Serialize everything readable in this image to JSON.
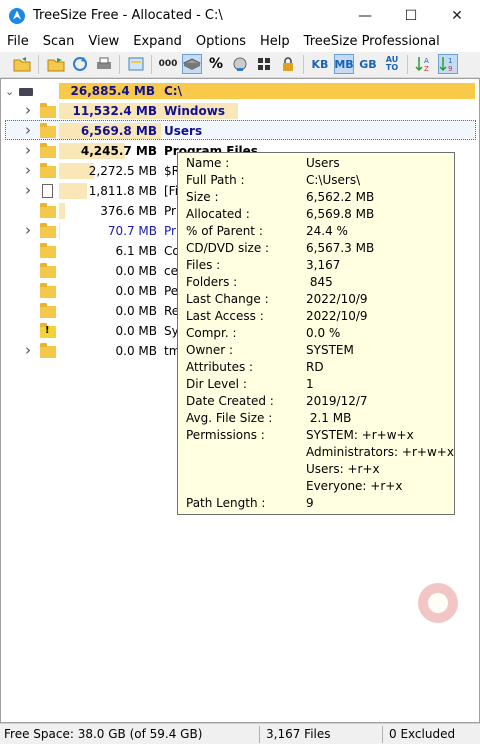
{
  "window": {
    "title": "TreeSize Free - Allocated - C:\\",
    "minimize_icon": "minimize-icon",
    "maximize_icon": "maximize-icon",
    "close_icon": "close-icon",
    "minimize_glyph": "—",
    "maximize_glyph": "☐",
    "close_glyph": "✕"
  },
  "menu": [
    "File",
    "Scan",
    "View",
    "Expand",
    "Options",
    "Help",
    "TreeSize Professional"
  ],
  "toolbar": {
    "kb": "KB",
    "mb": "MB",
    "gb": "GB",
    "auto": "AU TO",
    "percent": "%",
    "zeros": "000"
  },
  "tree": {
    "root": {
      "size": "26,885.4 MB",
      "name": "C:\\"
    },
    "rows": [
      {
        "size": "11,532.4 MB",
        "name": "Windows",
        "bar": 0.43,
        "bold": true,
        "color": "navy"
      },
      {
        "size": "6,569.8 MB",
        "name": "Users",
        "bar": 0.244,
        "bold": true,
        "color": "navy"
      },
      {
        "size": "4,245.7 MB",
        "name": "Program Files",
        "bar": 0.158,
        "bold": true,
        "color": "black"
      },
      {
        "size": "2,272.5 MB",
        "name": "$R",
        "bar": 0.085,
        "bold": false,
        "color": "black"
      },
      {
        "size": "1,811.8 MB",
        "name": "[Fi",
        "bar": 0.067,
        "bold": false,
        "color": "black"
      },
      {
        "size": "376.6 MB",
        "name": "Pr",
        "bar": 0.014,
        "bold": false,
        "color": "black"
      },
      {
        "size": "70.7 MB",
        "name": "Pr",
        "bar": 0.003,
        "bold": false,
        "color": "blue"
      },
      {
        "size": "6.1 MB",
        "name": "Co",
        "bar": 0.0,
        "bold": false,
        "color": "black"
      },
      {
        "size": "0.0 MB",
        "name": "ce",
        "bar": 0.0,
        "bold": false,
        "color": "black"
      },
      {
        "size": "0.0 MB",
        "name": "Pe",
        "bar": 0.0,
        "bold": false,
        "color": "black"
      },
      {
        "size": "0.0 MB",
        "name": "Re",
        "bar": 0.0,
        "bold": false,
        "color": "black"
      },
      {
        "size": "0.0 MB",
        "name": "Sy",
        "bar": 0.0,
        "bold": false,
        "color": "black"
      },
      {
        "size": "0.0 MB",
        "name": "tm",
        "bar": 0.0,
        "bold": false,
        "color": "black"
      }
    ]
  },
  "tooltip": {
    "rows": [
      {
        "label": "Name :",
        "value": "Users"
      },
      {
        "label": "Full Path :",
        "value": "C:\\Users\\"
      },
      {
        "label": "Size :",
        "value": "6,562.2 MB"
      },
      {
        "label": "Allocated :",
        "value": "6,569.8 MB"
      },
      {
        "label": "% of Parent :",
        "value": "24.4 %"
      },
      {
        "label": "CD/DVD size :",
        "value": "6,567.3 MB"
      },
      {
        "label": "Files :",
        "value": "3,167"
      },
      {
        "label": "Folders :",
        "value": " 845"
      },
      {
        "label": "Last Change :",
        "value": "2022/10/9"
      },
      {
        "label": "Last Access :",
        "value": "2022/10/9"
      },
      {
        "label": "Compr. :",
        "value": "0.0 %"
      },
      {
        "label": "Owner :",
        "value": "SYSTEM"
      },
      {
        "label": "Attributes :",
        "value": "RD"
      },
      {
        "label": "Dir Level :",
        "value": "1"
      },
      {
        "label": "Date Created :",
        "value": "2019/12/7"
      },
      {
        "label": "Avg. File Size :",
        "value": " 2.1 MB"
      },
      {
        "label": "Permissions :",
        "value": "SYSTEM: +r+w+x"
      },
      {
        "label": "",
        "value": "Administrators: +r+w+x"
      },
      {
        "label": "",
        "value": "Users: +r+x"
      },
      {
        "label": "",
        "value": "Everyone: +r+x"
      },
      {
        "label": "Path Length :",
        "value": "9"
      }
    ]
  },
  "status": {
    "free_space": "Free Space: 38.0 GB  (of 59.4 GB)",
    "files": "3,167  Files",
    "excluded": "0 Excluded"
  },
  "colors": {
    "bar": "#fae7b8",
    "root_bar": "#f9c94a",
    "tooltip_bg": "#ffffe1",
    "accent": "#1a63b8"
  }
}
